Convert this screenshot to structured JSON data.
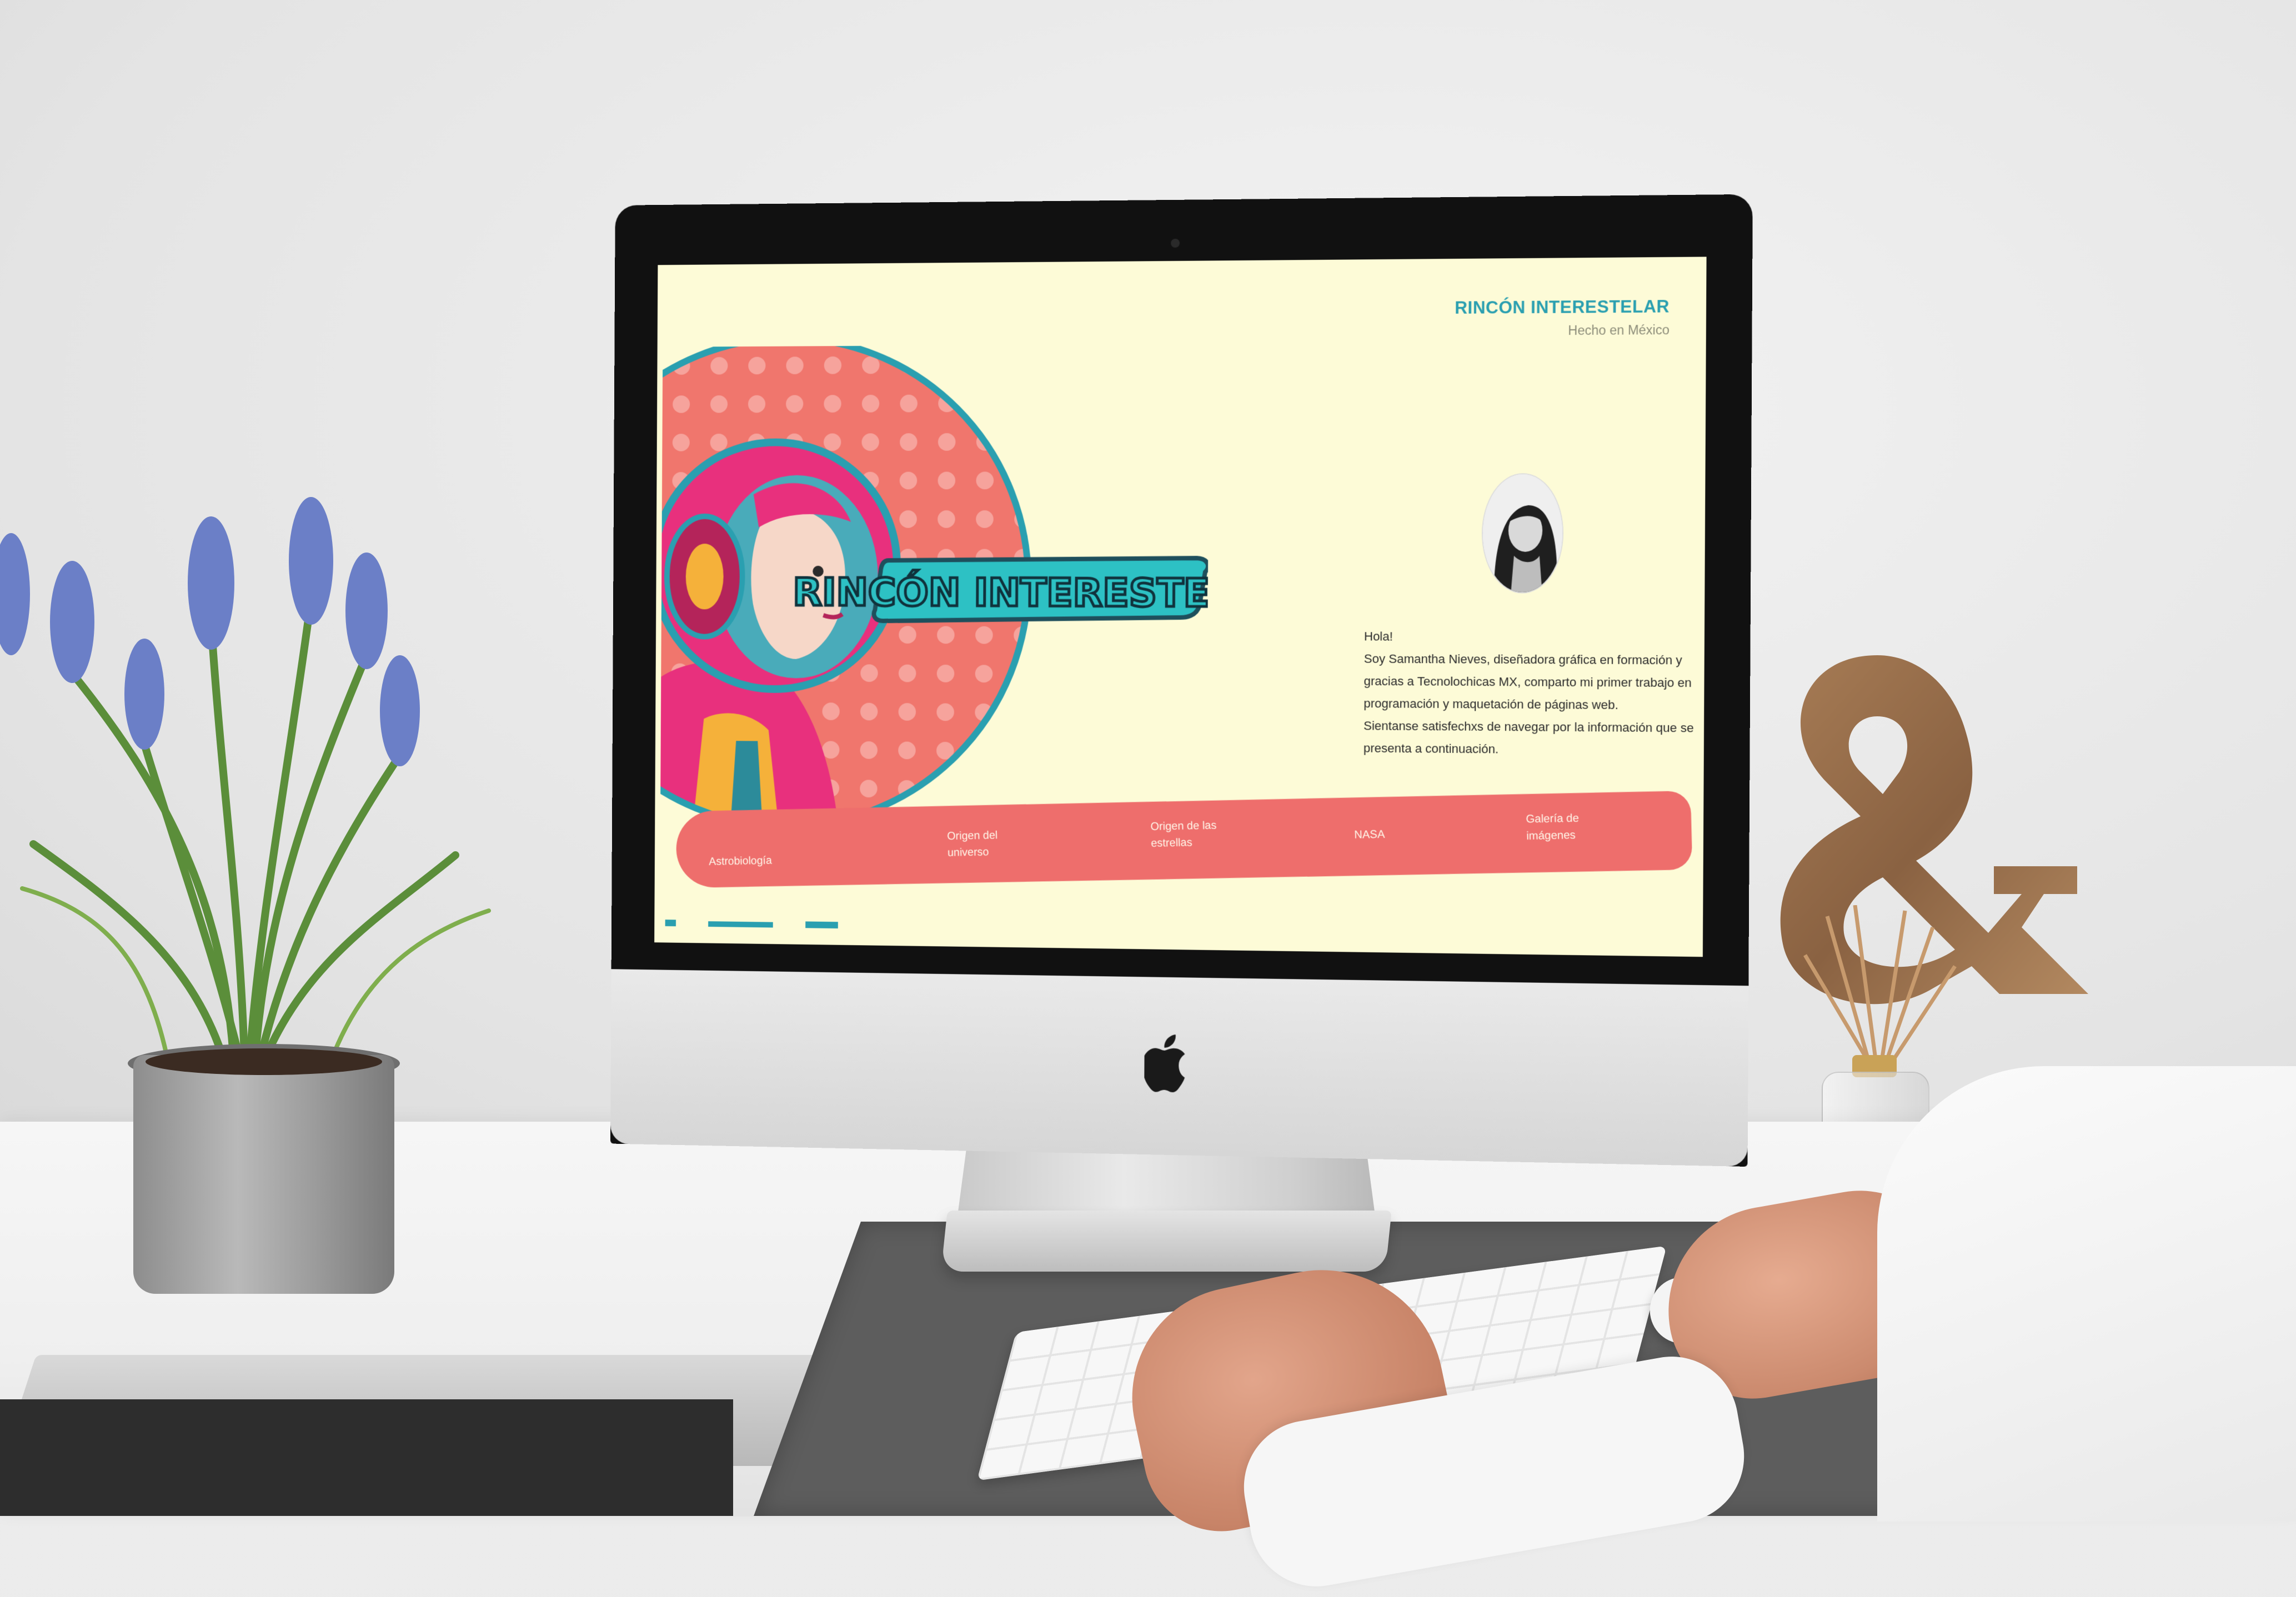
{
  "site": {
    "brand_title": "RINCÓN INTERESTELAR",
    "brand_subtitle": "Hecho en México",
    "hero_logo_text": "RINCÓN INTERESTELAR",
    "bio": {
      "line1": "Hola!",
      "line2": "Soy Samantha Nieves, diseñadora gráfica en formación y gracias a Tecnolochicas MX, comparto mi primer trabajo en programación y maquetación de páginas web.",
      "line3": "Sientanse satisfechxs de navegar por la información que se presenta a continuación."
    },
    "nav": {
      "item1": "Astrobiología",
      "item2": "Origen del universo",
      "item3": "Origen de las estrellas",
      "item4": "NASA",
      "item5": "Galería de imágenes"
    }
  },
  "colors": {
    "page_bg": "#fdfbd7",
    "accent_teal": "#2a9fb0",
    "nav_coral": "#ee6e6c",
    "hero_circle": "#f0766d",
    "astronaut_pink": "#e8307d"
  },
  "icons": {
    "apple_logo": "apple-logo-icon"
  }
}
